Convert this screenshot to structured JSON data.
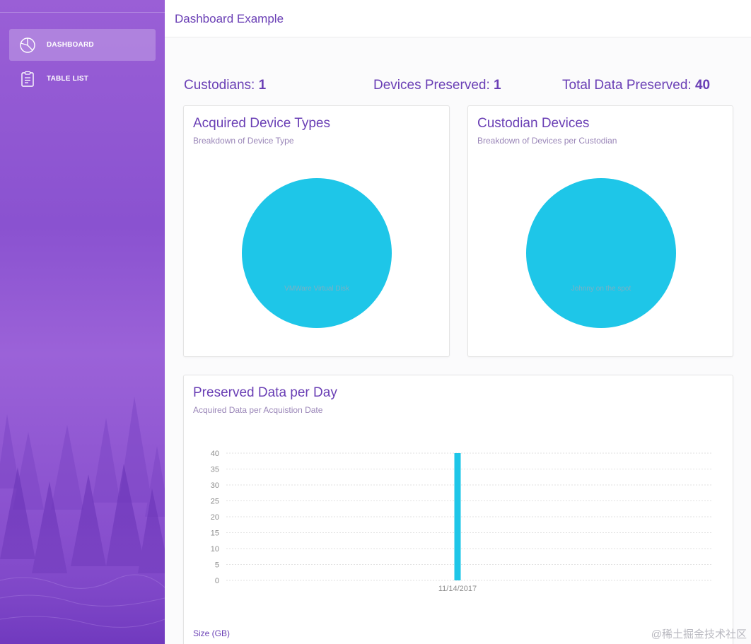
{
  "sidebar": {
    "items": [
      {
        "label": "DASHBOARD",
        "icon": "pie-chart-icon",
        "active": true
      },
      {
        "label": "TABLE LIST",
        "icon": "clipboard-icon",
        "active": false
      }
    ]
  },
  "header": {
    "title": "Dashboard Example"
  },
  "stats": {
    "custodians_label": "Custodians:",
    "custodians_value": "1",
    "devices_label": "Devices Preserved:",
    "devices_value": "1",
    "total_label": "Total Data Preserved:",
    "total_value": "40"
  },
  "cards": {
    "device_types": {
      "title": "Acquired Device Types",
      "subtitle": "Breakdown of Device Type"
    },
    "custodian_devices": {
      "title": "Custodian Devices",
      "subtitle": "Breakdown of Devices per Custodian"
    },
    "per_day": {
      "title": "Preserved Data per Day",
      "subtitle": "Acquired Data per Acquistion Date",
      "axis_label": "Size (GB)"
    }
  },
  "colors": {
    "accent": "#6a3fb5",
    "series": "#1ec6e8"
  },
  "watermark": "@稀土掘金技术社区",
  "chart_data": [
    {
      "type": "pie",
      "title": "Acquired Device Types",
      "slices": [
        {
          "label": "VMWare Virtual Disk",
          "value": 1
        }
      ],
      "colors": [
        "#1ec6e8"
      ]
    },
    {
      "type": "pie",
      "title": "Custodian Devices",
      "slices": [
        {
          "label": "Johnny on the spot",
          "value": 1
        }
      ],
      "colors": [
        "#1ec6e8"
      ]
    },
    {
      "type": "bar",
      "title": "Preserved Data per Day",
      "categories": [
        "11/14/2017"
      ],
      "values": [
        40
      ],
      "ylabel": "Size (GB)",
      "ylim": [
        0,
        40
      ],
      "yticks": [
        0,
        5,
        10,
        15,
        20,
        25,
        30,
        35,
        40
      ],
      "grid": true,
      "colors": [
        "#1ec6e8"
      ]
    }
  ]
}
